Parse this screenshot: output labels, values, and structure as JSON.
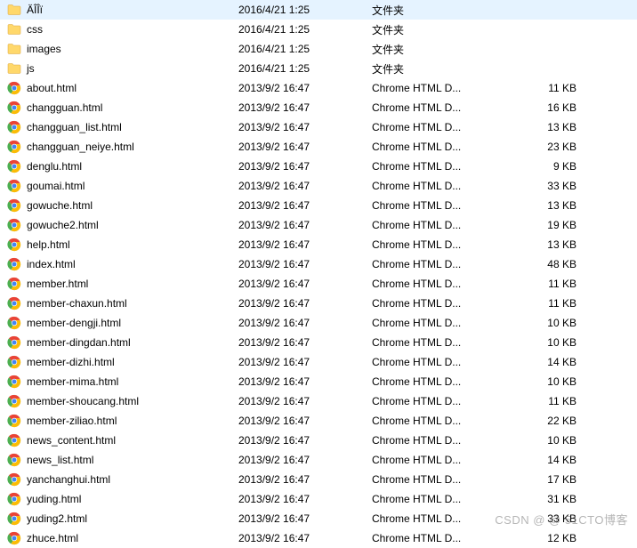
{
  "watermark": "CSDN @ @ 51CTO博客",
  "icons": {
    "folder": "folder-icon",
    "chrome": "chrome-icon"
  },
  "files": [
    {
      "icon": "folder",
      "name": "ÄÎÎï",
      "date": "2016/4/21 1:25",
      "type": "文件夹",
      "size": ""
    },
    {
      "icon": "folder",
      "name": "css",
      "date": "2016/4/21 1:25",
      "type": "文件夹",
      "size": ""
    },
    {
      "icon": "folder",
      "name": "images",
      "date": "2016/4/21 1:25",
      "type": "文件夹",
      "size": ""
    },
    {
      "icon": "folder",
      "name": "js",
      "date": "2016/4/21 1:25",
      "type": "文件夹",
      "size": ""
    },
    {
      "icon": "chrome",
      "name": "about.html",
      "date": "2013/9/2 16:47",
      "type": "Chrome HTML D...",
      "size": "11 KB"
    },
    {
      "icon": "chrome",
      "name": "changguan.html",
      "date": "2013/9/2 16:47",
      "type": "Chrome HTML D...",
      "size": "16 KB"
    },
    {
      "icon": "chrome",
      "name": "changguan_list.html",
      "date": "2013/9/2 16:47",
      "type": "Chrome HTML D...",
      "size": "13 KB"
    },
    {
      "icon": "chrome",
      "name": "changguan_neiye.html",
      "date": "2013/9/2 16:47",
      "type": "Chrome HTML D...",
      "size": "23 KB"
    },
    {
      "icon": "chrome",
      "name": "denglu.html",
      "date": "2013/9/2 16:47",
      "type": "Chrome HTML D...",
      "size": "9 KB"
    },
    {
      "icon": "chrome",
      "name": "goumai.html",
      "date": "2013/9/2 16:47",
      "type": "Chrome HTML D...",
      "size": "33 KB"
    },
    {
      "icon": "chrome",
      "name": "gowuche.html",
      "date": "2013/9/2 16:47",
      "type": "Chrome HTML D...",
      "size": "13 KB"
    },
    {
      "icon": "chrome",
      "name": "gowuche2.html",
      "date": "2013/9/2 16:47",
      "type": "Chrome HTML D...",
      "size": "19 KB"
    },
    {
      "icon": "chrome",
      "name": "help.html",
      "date": "2013/9/2 16:47",
      "type": "Chrome HTML D...",
      "size": "13 KB"
    },
    {
      "icon": "chrome",
      "name": "index.html",
      "date": "2013/9/2 16:47",
      "type": "Chrome HTML D...",
      "size": "48 KB"
    },
    {
      "icon": "chrome",
      "name": "member.html",
      "date": "2013/9/2 16:47",
      "type": "Chrome HTML D...",
      "size": "11 KB"
    },
    {
      "icon": "chrome",
      "name": "member-chaxun.html",
      "date": "2013/9/2 16:47",
      "type": "Chrome HTML D...",
      "size": "11 KB"
    },
    {
      "icon": "chrome",
      "name": "member-dengji.html",
      "date": "2013/9/2 16:47",
      "type": "Chrome HTML D...",
      "size": "10 KB"
    },
    {
      "icon": "chrome",
      "name": "member-dingdan.html",
      "date": "2013/9/2 16:47",
      "type": "Chrome HTML D...",
      "size": "10 KB"
    },
    {
      "icon": "chrome",
      "name": "member-dizhi.html",
      "date": "2013/9/2 16:47",
      "type": "Chrome HTML D...",
      "size": "14 KB"
    },
    {
      "icon": "chrome",
      "name": "member-mima.html",
      "date": "2013/9/2 16:47",
      "type": "Chrome HTML D...",
      "size": "10 KB"
    },
    {
      "icon": "chrome",
      "name": "member-shoucang.html",
      "date": "2013/9/2 16:47",
      "type": "Chrome HTML D...",
      "size": "11 KB"
    },
    {
      "icon": "chrome",
      "name": "member-ziliao.html",
      "date": "2013/9/2 16:47",
      "type": "Chrome HTML D...",
      "size": "22 KB"
    },
    {
      "icon": "chrome",
      "name": "news_content.html",
      "date": "2013/9/2 16:47",
      "type": "Chrome HTML D...",
      "size": "10 KB"
    },
    {
      "icon": "chrome",
      "name": "news_list.html",
      "date": "2013/9/2 16:47",
      "type": "Chrome HTML D...",
      "size": "14 KB"
    },
    {
      "icon": "chrome",
      "name": "yanchanghui.html",
      "date": "2013/9/2 16:47",
      "type": "Chrome HTML D...",
      "size": "17 KB"
    },
    {
      "icon": "chrome",
      "name": "yuding.html",
      "date": "2013/9/2 16:47",
      "type": "Chrome HTML D...",
      "size": "31 KB"
    },
    {
      "icon": "chrome",
      "name": "yuding2.html",
      "date": "2013/9/2 16:47",
      "type": "Chrome HTML D...",
      "size": "33 KB"
    },
    {
      "icon": "chrome",
      "name": "zhuce.html",
      "date": "2013/9/2 16:47",
      "type": "Chrome HTML D...",
      "size": "12 KB"
    }
  ]
}
